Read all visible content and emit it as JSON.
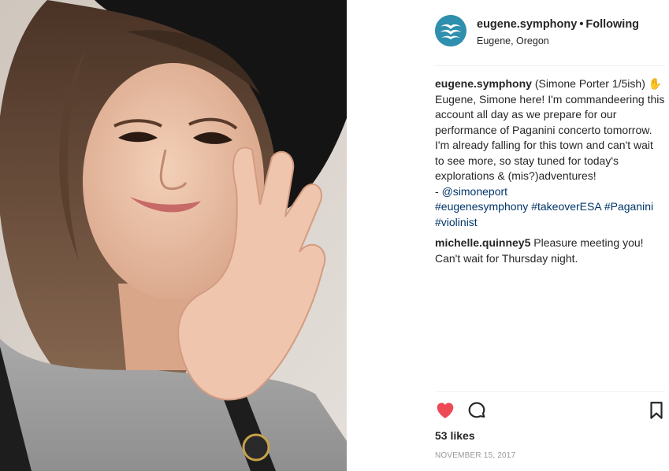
{
  "post": {
    "image_alt": "Selfie of a smiling woman in a black hat waving at the camera",
    "username": "eugene.symphony",
    "separator": "•",
    "follow_status": "Following",
    "location": "Eugene, Oregon"
  },
  "caption": {
    "username": "eugene.symphony",
    "text_line1": "(Simone Porter 1/5ish) ✋",
    "text_body": "Eugene, Simone here! I'm commandeering this account all day as we prepare for our performance of Paganini concerto tomorrow. I'm already falling for this town and can't wait to see more, so stay tuned for today's explorations & (mis?)adventures!",
    "signoff_prefix": "- ",
    "mention": "@simoneport",
    "hashtags": [
      "#eugenesymphony",
      "#takeoverESA",
      "#Paganini",
      "#violinist"
    ]
  },
  "reply": {
    "username": "michelle.quinney5",
    "text": "Pleasure meeting you! Can't wait for Thursday night."
  },
  "actions": {
    "like_icon": "heart-icon",
    "comment_icon": "comment-icon",
    "save_icon": "bookmark-icon",
    "liked": true,
    "like_color": "#ed4956"
  },
  "stats": {
    "likes": "53 likes",
    "date": "NOVEMBER 15, 2017"
  },
  "colors": {
    "link": "#003569",
    "text": "#262626",
    "muted": "#999999",
    "avatar": "#2f8fae"
  }
}
